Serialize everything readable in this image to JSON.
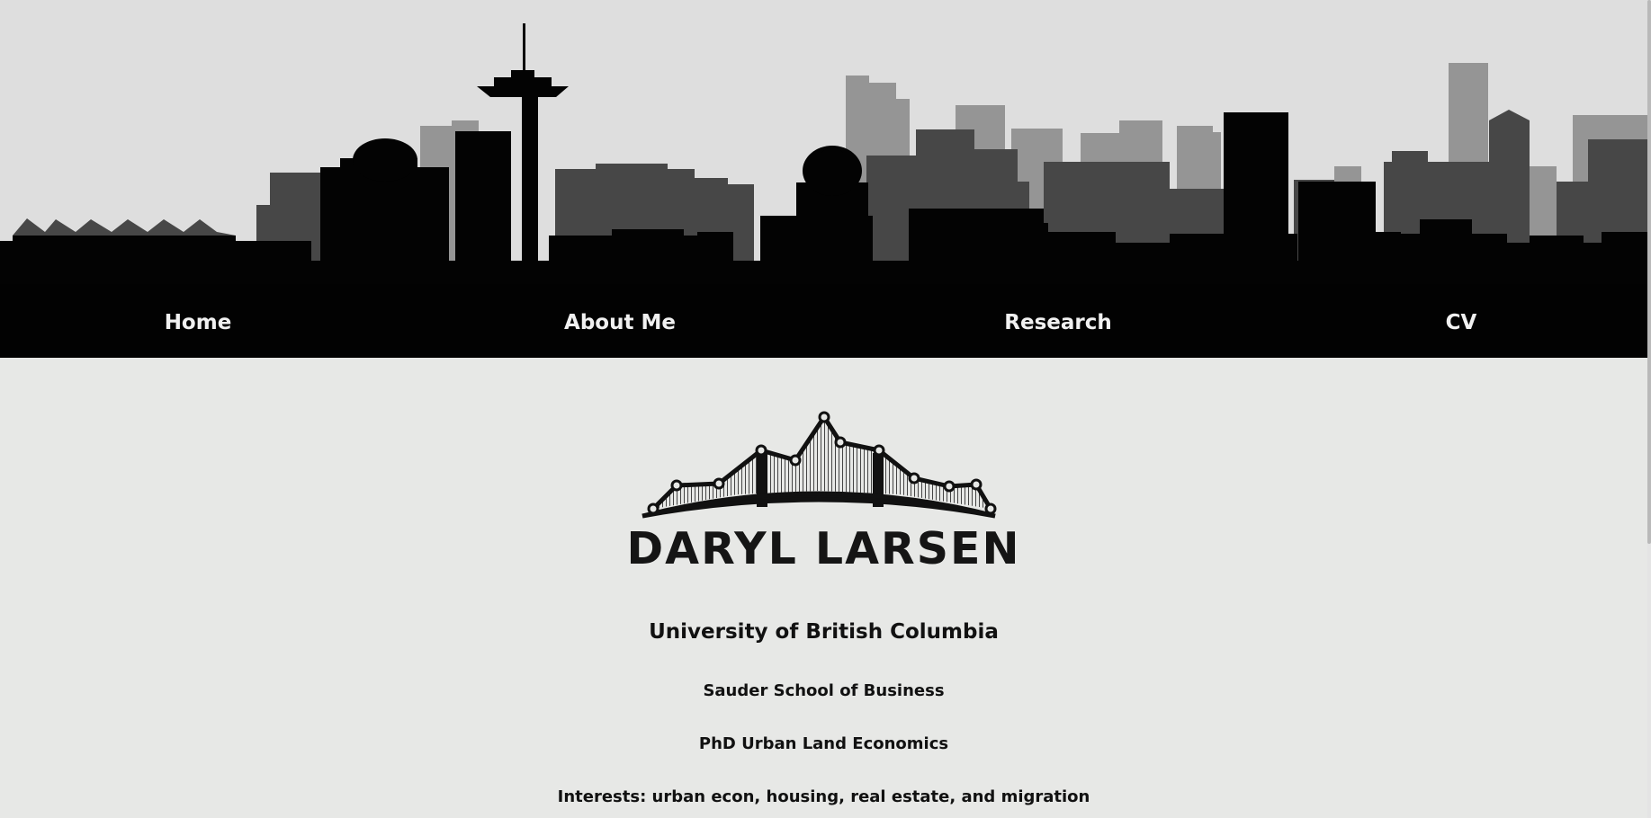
{
  "nav": {
    "items": [
      {
        "label": "Home"
      },
      {
        "label": "About Me"
      },
      {
        "label": "Research"
      },
      {
        "label": "CV"
      }
    ]
  },
  "profile": {
    "logo_text": "DARYL LARSEN",
    "university": "University of British Columbia",
    "school": "Sauder School of Business",
    "degree": "PhD Urban Land Economics",
    "interests": "Interests: urban econ, housing, real estate, and migration"
  },
  "colors": {
    "banner_background": "#dedede",
    "skyline_far": "#959595",
    "skyline_mid": "#474747",
    "skyline_front": "#030303",
    "page_background": "#e7e8e6",
    "nav_text": "#f1f1f1"
  },
  "icons": {
    "banner": "city-skyline-illustration",
    "logo": "bridge-graph-logo"
  }
}
